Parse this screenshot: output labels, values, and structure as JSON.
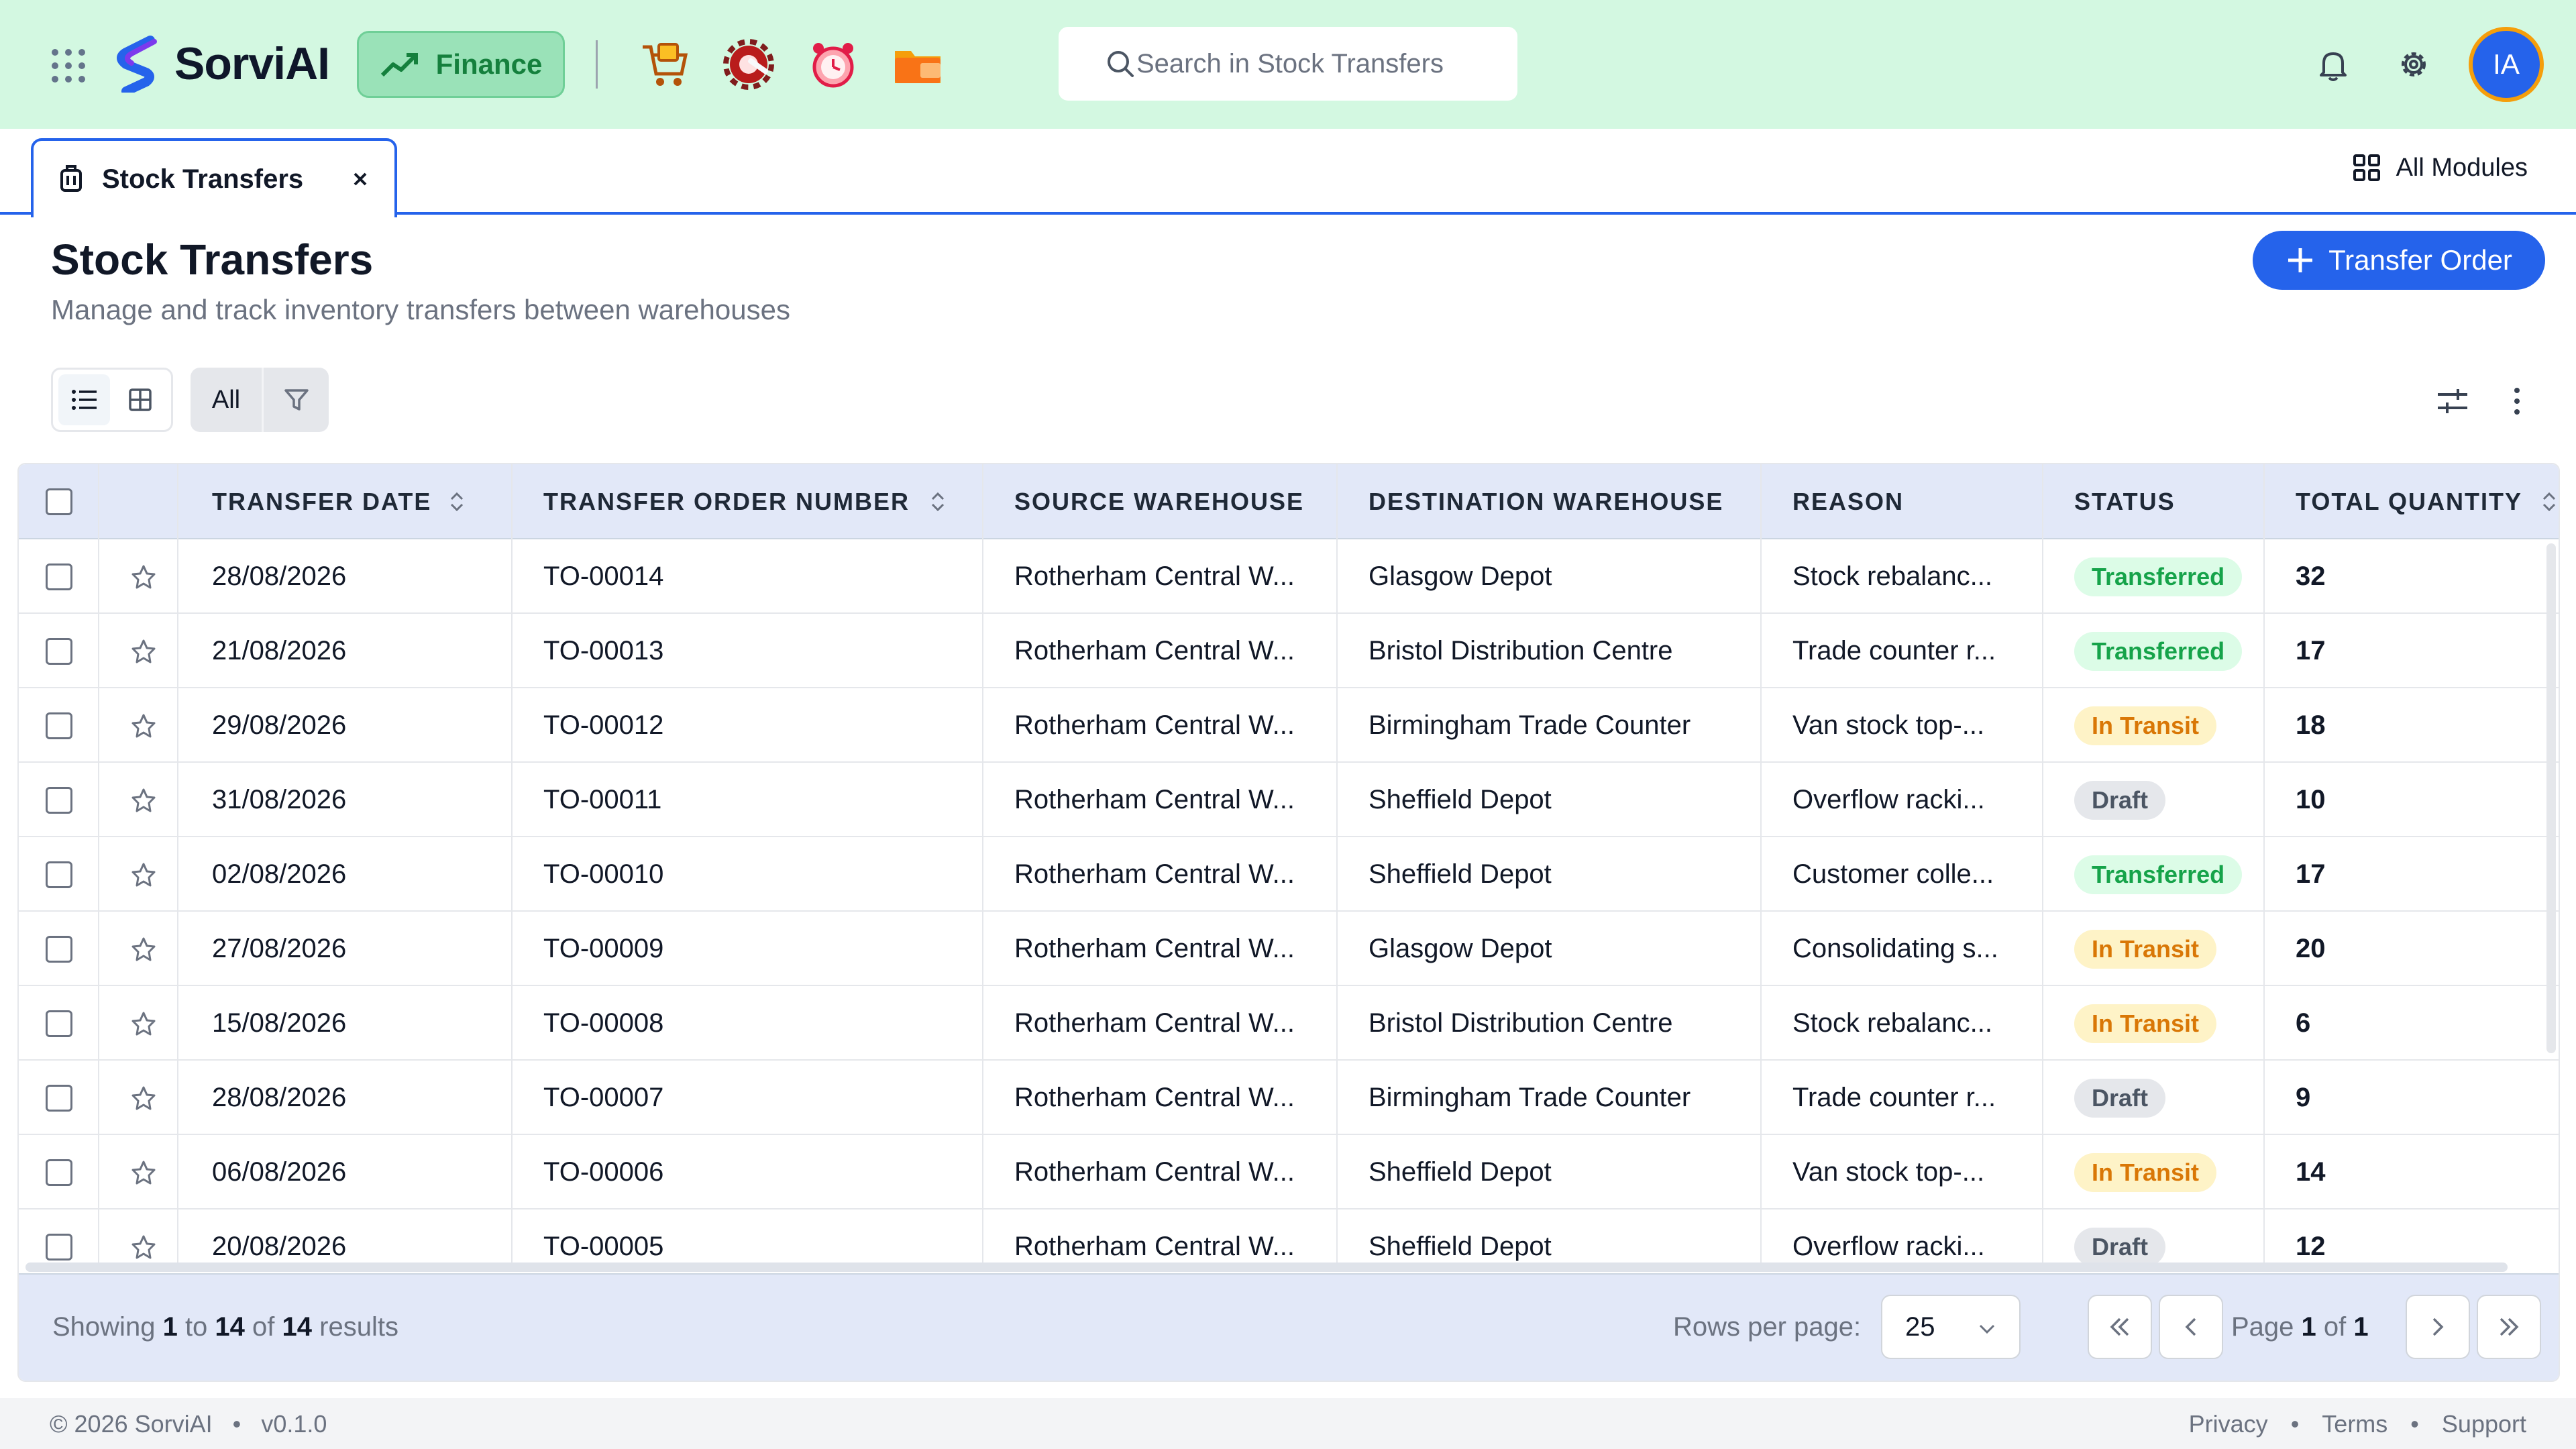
{
  "app": {
    "brand": "SorviAI",
    "module": "Finance",
    "search_placeholder": "Search in Stock Transfers",
    "avatar_initials": "IA",
    "accent": "#2563eb",
    "topbar_color": "#d3f8e1",
    "app_icons": [
      "shopping-cart-box-icon",
      "gear-wrench-icon",
      "alarm-clock-icon",
      "folder-briefcase-icon"
    ]
  },
  "tabs": {
    "active_label": "Stock Transfers",
    "all_modules": "All Modules"
  },
  "page": {
    "title": "Stock Transfers",
    "subtitle": "Manage and track inventory transfers between warehouses",
    "primary_action": "Transfer Order"
  },
  "toolbar": {
    "filter_label": "All"
  },
  "table": {
    "columns": [
      "TRANSFER DATE",
      "TRANSFER ORDER NUMBER",
      "SOURCE WAREHOUSE",
      "DESTINATION WAREHOUSE",
      "REASON",
      "STATUS",
      "TOTAL QUANTITY"
    ],
    "rows": [
      {
        "date": "28/08/2026",
        "number": "TO-00014",
        "source": "Rotherham Central W...",
        "destination": "Glasgow Depot",
        "reason": "Stock rebalanc...",
        "status": "Transferred",
        "status_kind": "t",
        "qty": "32"
      },
      {
        "date": "21/08/2026",
        "number": "TO-00013",
        "source": "Rotherham Central W...",
        "destination": "Bristol Distribution Centre",
        "reason": "Trade counter r...",
        "status": "Transferred",
        "status_kind": "t",
        "qty": "17"
      },
      {
        "date": "29/08/2026",
        "number": "TO-00012",
        "source": "Rotherham Central W...",
        "destination": "Birmingham Trade Counter",
        "reason": "Van stock top-...",
        "status": "In Transit",
        "status_kind": "i",
        "qty": "18"
      },
      {
        "date": "31/08/2026",
        "number": "TO-00011",
        "source": "Rotherham Central W...",
        "destination": "Sheffield Depot",
        "reason": "Overflow racki...",
        "status": "Draft",
        "status_kind": "d",
        "qty": "10"
      },
      {
        "date": "02/08/2026",
        "number": "TO-00010",
        "source": "Rotherham Central W...",
        "destination": "Sheffield Depot",
        "reason": "Customer colle...",
        "status": "Transferred",
        "status_kind": "t",
        "qty": "17"
      },
      {
        "date": "27/08/2026",
        "number": "TO-00009",
        "source": "Rotherham Central W...",
        "destination": "Glasgow Depot",
        "reason": "Consolidating s...",
        "status": "In Transit",
        "status_kind": "i",
        "qty": "20"
      },
      {
        "date": "15/08/2026",
        "number": "TO-00008",
        "source": "Rotherham Central W...",
        "destination": "Bristol Distribution Centre",
        "reason": "Stock rebalanc...",
        "status": "In Transit",
        "status_kind": "i",
        "qty": "6"
      },
      {
        "date": "28/08/2026",
        "number": "TO-00007",
        "source": "Rotherham Central W...",
        "destination": "Birmingham Trade Counter",
        "reason": "Trade counter r...",
        "status": "Draft",
        "status_kind": "d",
        "qty": "9"
      },
      {
        "date": "06/08/2026",
        "number": "TO-00006",
        "source": "Rotherham Central W...",
        "destination": "Sheffield Depot",
        "reason": "Van stock top-...",
        "status": "In Transit",
        "status_kind": "i",
        "qty": "14"
      },
      {
        "date": "20/08/2026",
        "number": "TO-00005",
        "source": "Rotherham Central W...",
        "destination": "Sheffield Depot",
        "reason": "Overflow racki...",
        "status": "Draft",
        "status_kind": "d",
        "qty": "12"
      }
    ]
  },
  "pagination": {
    "showing_prefix": "Showing",
    "from": "1",
    "to_word": "to",
    "to": "14",
    "of_word": "of",
    "total": "14",
    "results_word": "results",
    "rows_per_page_label": "Rows per page:",
    "rows_per_page": "25",
    "page_word": "Page",
    "page": "1",
    "page_of": "of",
    "pages": "1"
  },
  "footer": {
    "copyright": "© 2026 SorviAI",
    "version": "v0.1.0",
    "links": [
      "Privacy",
      "Terms",
      "Support"
    ]
  }
}
